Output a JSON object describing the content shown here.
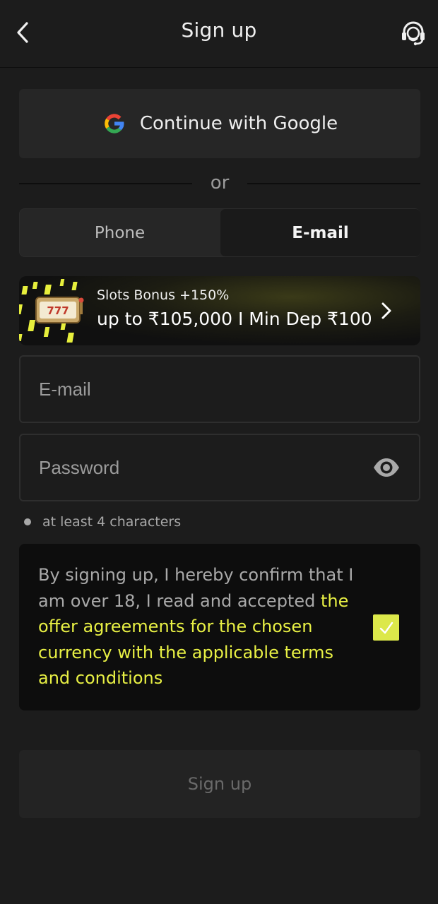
{
  "header": {
    "title": "Sign up",
    "back_icon": "chevron-left-icon",
    "support_icon": "headset-support-icon"
  },
  "google": {
    "label": "Continue with Google",
    "icon": "google-logo-icon"
  },
  "divider": {
    "text": "or"
  },
  "tabs": [
    {
      "label": "Phone",
      "active": false
    },
    {
      "label": "E-mail",
      "active": true
    }
  ],
  "banner": {
    "subtitle": "Slots Bonus +150%",
    "title": "up to ₹105,000 I Min Dep ₹100",
    "slot_text": "777",
    "icon": "chevron-right-icon",
    "accent_color": "#e7ef3c"
  },
  "form": {
    "email_placeholder": "E-mail",
    "email_value": "",
    "password_placeholder": "Password",
    "password_value": "",
    "password_hint": "at least 4 characters",
    "eye_icon": "eye-icon"
  },
  "terms": {
    "text_prefix": "By signing up, I hereby confirm that I am over 18, I read and accepted ",
    "link_text": "the offer agreements for the chosen currency with the applicable terms and conditions",
    "checked": true,
    "link_color": "#e8f044"
  },
  "submit": {
    "label": "Sign up",
    "enabled": false
  }
}
